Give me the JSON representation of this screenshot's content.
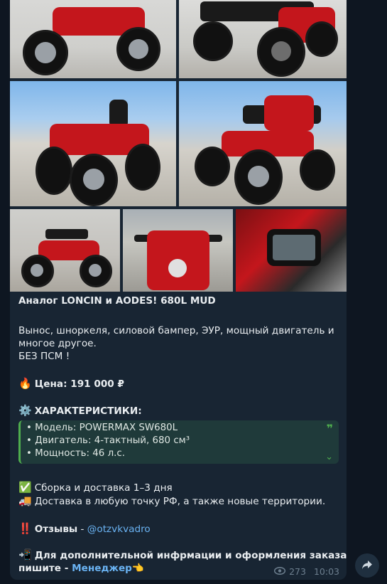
{
  "message": {
    "title": "Аналог LONCIN и AODES!  680L MUD",
    "desc_line1": "Вынос, шноркеля, силовой бампер, ЭУР, мощный двигатель и",
    "desc_line2": "многое другое.",
    "desc_line3": "БЕЗ ПСМ !",
    "price_emoji": "🔥",
    "price": "Цена: 191 000 ₽",
    "specs_emoji": "⚙️",
    "specs_header": "ХАРАКТЕРИСТИКИ:",
    "specs": [
      "• Модель: POWERMAX SW680L",
      "• Двигатель: 4-тактный, 680 см³",
      "• Мощность: 46 л.с."
    ],
    "assembly_emoji": "✅",
    "assembly": "Сборка и доставка 1–3 дня",
    "delivery_emoji": "🚚",
    "delivery": "Доставка в любую точку РФ, а также новые территории.",
    "reviews_emoji": "‼️",
    "reviews_label": "Отзывы",
    "reviews_sep": " - ",
    "reviews_link": "@otzvkvadro",
    "contact_emoji": "📲",
    "contact_line1": "Для дополнительной инфрмации и оформления заказа",
    "contact_line2": "пишите - ",
    "manager_link": "Менеджер",
    "manager_emoji": "👈",
    "views": "273",
    "time": "10:03"
  },
  "icons": {
    "quote": "quote-icon",
    "expand": "chevron-down-icon",
    "views": "eye-icon",
    "share": "share-icon"
  },
  "colors": {
    "background": "#0e1621",
    "bubble": "#182533",
    "accent_link": "#6ab3f3",
    "quote_bar": "#4fae4e"
  }
}
